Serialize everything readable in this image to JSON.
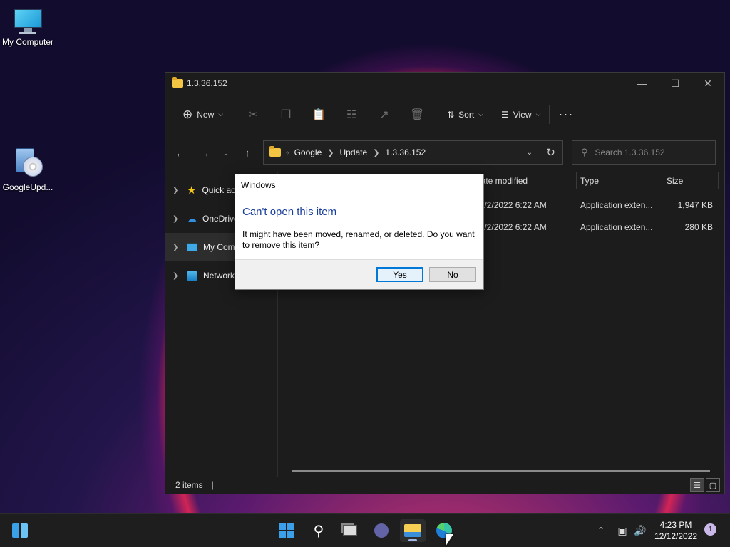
{
  "desktop": {
    "icons": [
      {
        "label": "My Computer",
        "icon": "computer-icon"
      },
      {
        "label": "GoogleUpd...",
        "icon": "installer-disc-icon"
      }
    ]
  },
  "explorer": {
    "title": "1.3.36.152",
    "toolbar": {
      "new_label": "New",
      "sort_label": "Sort",
      "view_label": "View",
      "disabled_icons": [
        "cut-icon",
        "copy-icon",
        "paste-icon",
        "rename-icon",
        "share-icon",
        "delete-icon"
      ]
    },
    "breadcrumb": [
      "Google",
      "Update",
      "1.3.36.152"
    ],
    "search": {
      "placeholder": "Search 1.3.36.152"
    },
    "sidebar": {
      "items": [
        {
          "label": "Quick access",
          "icon": "star-icon"
        },
        {
          "label": "OneDrive",
          "icon": "cloud-icon"
        },
        {
          "label": "My Computer",
          "icon": "computer-icon",
          "selected": true
        },
        {
          "label": "Network",
          "icon": "network-icon"
        }
      ]
    },
    "columns": {
      "date": "Date modified",
      "type": "Type",
      "size": "Size"
    },
    "rows": [
      {
        "date": "12/2/2022 6:22 AM",
        "type": "Application exten...",
        "size": "1,947 KB"
      },
      {
        "date": "12/2/2022 6:22 AM",
        "type": "Application exten...",
        "size": "280 KB"
      }
    ],
    "status": "2 items"
  },
  "dialog": {
    "caption": "Windows",
    "heading": "Can't open this item",
    "message": "It might have been moved, renamed, or deleted. Do you want to remove this item?",
    "yes_label": "Yes",
    "no_label": "No"
  },
  "taskbar": {
    "apps": [
      "start-icon",
      "search-icon",
      "task-view-icon",
      "chat-icon",
      "file-explorer-icon",
      "edge-icon"
    ],
    "clock_time": "4:23 PM",
    "clock_date": "12/12/2022",
    "notification_count": "1"
  },
  "colors": {
    "dialog_heading": "#1a3e9c",
    "default_button_border": "#0078d7"
  }
}
